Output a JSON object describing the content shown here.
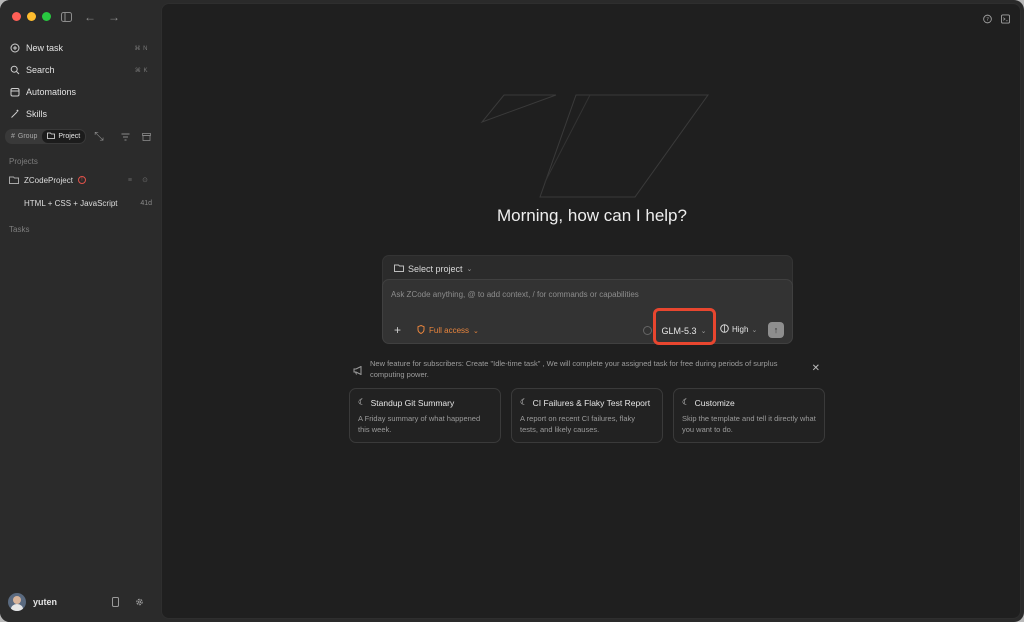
{
  "sidebar": {
    "nav": [
      {
        "label": "New task",
        "shortcut": "⌘ N"
      },
      {
        "label": "Search",
        "shortcut": "⌘ K"
      },
      {
        "label": "Automations"
      },
      {
        "label": "Skills"
      }
    ],
    "group_toggle": {
      "group": "Group",
      "project": "Project"
    },
    "projects_label": "Projects",
    "project_name": "ZCodeProject",
    "task_title": "HTML + CSS + JavaScript",
    "task_age": "41d",
    "tasks_label": "Tasks",
    "user_name": "yuten"
  },
  "main": {
    "greeting": "Morning, how can I help?",
    "select_project": "Select project",
    "placeholder": "Ask ZCode anything, @ to add context, / for commands or capabilities",
    "access_label": "Full access",
    "model": "GLM-5.3",
    "effort": "High",
    "notice": "New feature for subscribers: Create \"Idle-time task\" , We will complete your assigned task for free during periods of surplus computing power.",
    "cards": [
      {
        "title": "Standup Git Summary",
        "desc": "A Friday summary of what happened this week."
      },
      {
        "title": "CI Failures & Flaky Test Report",
        "desc": "A report on recent CI failures, flaky tests, and likely causes."
      },
      {
        "title": "Customize",
        "desc": "Skip the template and tell it directly what you want to do."
      }
    ]
  },
  "colors": {
    "accent_orange": "#e9853d",
    "highlight_red": "#e8462f",
    "close": "#ff5f57",
    "minimize": "#febc2e",
    "maximize": "#28c840"
  }
}
